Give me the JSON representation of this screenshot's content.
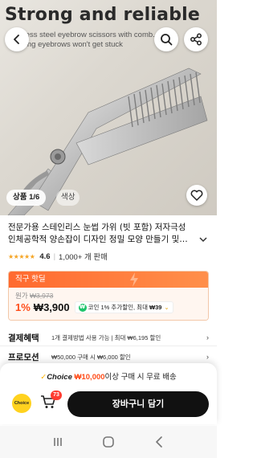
{
  "hero": {
    "title": "Strong and reliable",
    "subtitle": "Stainless steel  eyebrow scissors with comb. Thinning eyebrows won't get stuck",
    "image_counter": "상품 1/6",
    "color_tab": "색상"
  },
  "product": {
    "title_line1": "전문가용 스테인리스 눈썹 가위 (빗 포함) 저자극성",
    "title_line2": "인체공학적 양손잡이 디자인 정밀 모양 만들기 및…",
    "stars": "★★★★★",
    "rating": "4.6",
    "sold": "1,000+ 개 판매"
  },
  "deal": {
    "header": "직구 핫딜",
    "original_label": "원가",
    "original_price": "₩3,973",
    "discount": "1%",
    "price": "₩3,900",
    "coin_text": "코인 1% 추가할인, 최대",
    "coin_amount": "₩39"
  },
  "benefits": [
    {
      "label": "결제혜택",
      "text": "1개 결제방법 사용 가능 | 최대 ₩6,195 할인"
    },
    {
      "label": "프로모션",
      "text": "₩50,000 구매 시 ₩6,000 할인"
    }
  ],
  "sheet": {
    "check": "✓",
    "choice": "Choice",
    "amount": "₩10,000",
    "free_text": "이상 구매 시 무료 배송",
    "choice_badge": "Choice",
    "cart_count": "73",
    "cart_button": "장바구니 담기"
  },
  "colors": {
    "accent": "#ff4d1a",
    "deal_header": "#ff6a2f",
    "cart_button": "#111111",
    "choice_yellow": "#ffd21f",
    "badge_red": "#ff3b30"
  },
  "icons": [
    "back-icon",
    "search-icon",
    "share-icon",
    "heart-icon",
    "chevron-down-icon",
    "cart-icon",
    "recents-icon",
    "home-icon",
    "nav-back-icon"
  ]
}
